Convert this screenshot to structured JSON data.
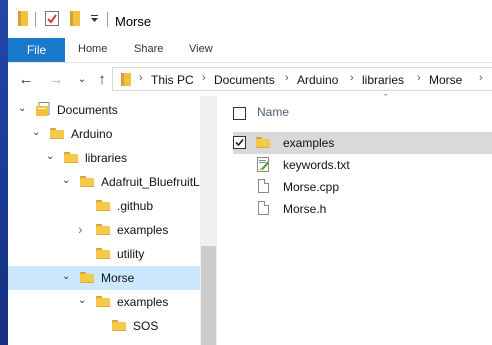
{
  "window": {
    "title": "Morse"
  },
  "ribbon": {
    "file": "File",
    "tabs": [
      "Home",
      "Share",
      "View"
    ]
  },
  "address": {
    "parts": [
      "This PC",
      "Documents",
      "Arduino",
      "libraries",
      "Morse"
    ]
  },
  "tree": [
    {
      "label": "Documents",
      "icon": "documents-icon",
      "arrow": "expanded",
      "indent": 1
    },
    {
      "label": "Arduino",
      "icon": "folder-icon",
      "arrow": "expanded",
      "indent": 2
    },
    {
      "label": "libraries",
      "icon": "folder-icon",
      "arrow": "expanded",
      "indent": 3
    },
    {
      "label": "Adafruit_BluefruitLE_n",
      "icon": "folder-icon",
      "arrow": "expanded",
      "indent": 4
    },
    {
      "label": ".github",
      "icon": "folder-icon",
      "arrow": "none",
      "indent": 5
    },
    {
      "label": "examples",
      "icon": "folder-icon",
      "arrow": "collapsed",
      "indent": 5
    },
    {
      "label": "utility",
      "icon": "folder-icon",
      "arrow": "none",
      "indent": 5
    },
    {
      "label": "Morse",
      "icon": "folder-icon",
      "arrow": "expanded",
      "indent": 4,
      "selected": true
    },
    {
      "label": "examples",
      "icon": "folder-icon",
      "arrow": "expanded",
      "indent": 5
    },
    {
      "label": "SOS",
      "icon": "folder-icon",
      "arrow": "none",
      "indent": 6
    }
  ],
  "content": {
    "column_name": "Name",
    "files": [
      {
        "name": "examples",
        "icon": "folder-icon",
        "checked": true,
        "highlighted": true
      },
      {
        "name": "keywords.txt",
        "icon": "text-file-icon"
      },
      {
        "name": "Morse.cpp",
        "icon": "document-icon"
      },
      {
        "name": "Morse.h",
        "icon": "document-icon"
      }
    ]
  },
  "colors": {
    "accent": "#1979ca",
    "selection": "#cce8ff",
    "hover": "#d9d9d9",
    "folder": "#f5c94a"
  }
}
